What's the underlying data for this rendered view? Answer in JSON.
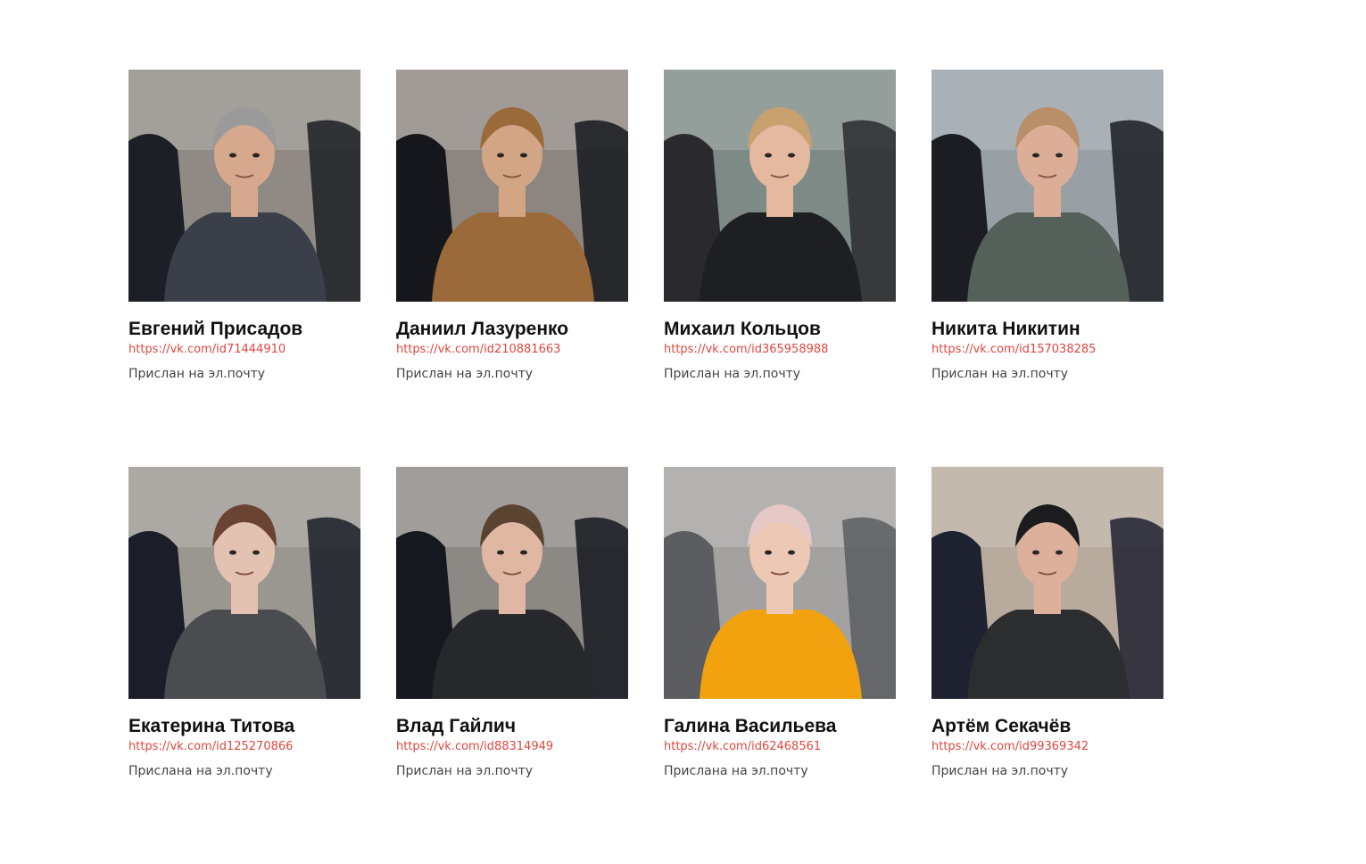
{
  "people": [
    {
      "name": "Евгений Присадов",
      "link": "https://vk.com/id71444910",
      "note": "Прислан на эл.почту",
      "photo": {
        "bg": "#8f8a84",
        "coat": "#3a3f4a",
        "hat": "#9a9a9a",
        "skin": "#d6a88e",
        "hair": "#9a9a9a",
        "side": "#1c1f25"
      }
    },
    {
      "name": "Даниил Лазуренко",
      "link": "https://vk.com/id210881663",
      "note": "Прислан на эл.почту",
      "photo": {
        "bg": "#8d8580",
        "coat": "#9b6a3a",
        "hat": "#9b6a3a",
        "skin": "#d2a584",
        "hair": "#2b2520",
        "side": "#15171c"
      }
    },
    {
      "name": "Михаил Кольцов",
      "link": "https://vk.com/id365958988",
      "note": "Прислан на эл.почту",
      "photo": {
        "bg": "#7d8a86",
        "coat": "#1d1f22",
        "hat": "#c9a070",
        "skin": "#e4b9a0",
        "hair": "#c9a070",
        "side": "#2a2a2e"
      }
    },
    {
      "name": "Никита Никитин",
      "link": "https://vk.com/id157038285",
      "note": "Прислан на эл.почту",
      "photo": {
        "bg": "#98a0a6",
        "coat": "#56605a",
        "hat": "#b98f6a",
        "skin": "#dcae98",
        "hair": "#b98f6a",
        "side": "#1b1d22"
      }
    },
    {
      "name": "Екатерина Титова",
      "link": "https://vk.com/id125270866",
      "note": "Прислана на эл.почту",
      "photo": {
        "bg": "#9a9690",
        "coat": "#4b4c50",
        "hat": "#6a4332",
        "skin": "#e3c2b2",
        "hair": "#6a4332",
        "side": "#1b1e28"
      }
    },
    {
      "name": "Влад Гайлич",
      "link": "https://vk.com/id88314949",
      "note": "Прислан на эл.почту",
      "photo": {
        "bg": "#8c8884",
        "coat": "#27282b",
        "hat": "#5a4330",
        "skin": "#dfb7a2",
        "hair": "#5a4330",
        "side": "#161820"
      }
    },
    {
      "name": "Галина Васильева",
      "link": "https://vk.com/id62468561",
      "note": "Прислана на эл.почту",
      "photo": {
        "bg": "#a3a2a0",
        "coat": "#f2a20e",
        "hat": "#e6c9c6",
        "skin": "#edc8b4",
        "hair": "#e8c58a",
        "side": "#5b5d60"
      }
    },
    {
      "name": "Артём Секачёв",
      "link": "https://vk.com/id99369342",
      "note": "Прислан на эл.почту",
      "photo": {
        "bg": "#b8aa9c",
        "coat": "#2b2d2f",
        "hat": "#1c1c1f",
        "skin": "#dcb09b",
        "hair": "#3a2a20",
        "side": "#1e2130"
      }
    }
  ]
}
